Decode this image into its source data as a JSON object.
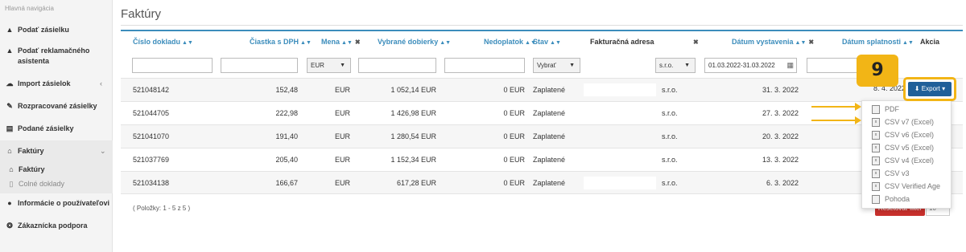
{
  "sidebar": {
    "title": "Hlavná navigácia",
    "items": [
      {
        "label": "Podať zásielku",
        "icon": "truck-icon"
      },
      {
        "label": "Podať reklamačného asistenta",
        "icon": "truck-icon"
      },
      {
        "label": "Import zásielok",
        "icon": "cloud-upload-icon"
      },
      {
        "label": "Rozpracované zásielky",
        "icon": "edit-icon"
      },
      {
        "label": "Podané zásielky",
        "icon": "archive-icon"
      },
      {
        "label": "Faktúry",
        "icon": "bank-icon"
      },
      {
        "label": "Informácie o používateľovi",
        "icon": "user-icon"
      },
      {
        "label": "Zákaznícka podpora",
        "icon": "support-icon"
      }
    ],
    "subitems": [
      {
        "label": "Faktúry",
        "icon": "bank-icon"
      },
      {
        "label": "Colné doklady",
        "icon": "document-icon"
      }
    ]
  },
  "page": {
    "title": "Faktúry"
  },
  "table": {
    "headers": {
      "doc_number": "Číslo dokladu",
      "amount": "Čiastka s DPH",
      "currency": "Mena",
      "collected": "Vybrané dobierky",
      "unpaid": "Nedoplatok",
      "status": "Stav",
      "address": "Fakturačná adresa",
      "issued": "Dátum vystavenia",
      "due": "Dátum splatnosti",
      "action": "Akcia"
    },
    "filters": {
      "currency": "EUR",
      "status": "Vybrať",
      "company": "s.r.o.",
      "date_range": "01.03.2022-31.03.2022"
    },
    "rows": [
      {
        "doc": "521048142",
        "amount": "152,48",
        "currency": "EUR",
        "collected": "1 052,14 EUR",
        "unpaid": "0 EUR",
        "status": "Zaplatené",
        "company": "s.r.o.",
        "issued": "31. 3. 2022",
        "due": "8. 4. 2022"
      },
      {
        "doc": "521044705",
        "amount": "222,98",
        "currency": "EUR",
        "collected": "1 426,98 EUR",
        "unpaid": "0 EUR",
        "status": "Zaplatené",
        "company": "s.r.o.",
        "issued": "27. 3. 2022",
        "due": ""
      },
      {
        "doc": "521041070",
        "amount": "191,40",
        "currency": "EUR",
        "collected": "1 280,54 EUR",
        "unpaid": "0 EUR",
        "status": "Zaplatené",
        "company": "s.r.o.",
        "issued": "20. 3. 2022",
        "due": ""
      },
      {
        "doc": "521037769",
        "amount": "205,40",
        "currency": "EUR",
        "collected": "1 152,34 EUR",
        "unpaid": "0 EUR",
        "status": "Zaplatené",
        "company": "s.r.o.",
        "issued": "13. 3. 2022",
        "due": ""
      },
      {
        "doc": "521034138",
        "amount": "166,67",
        "currency": "EUR",
        "collected": "617,28 EUR",
        "unpaid": "0 EUR",
        "status": "Zaplatené",
        "company": "s.r.o.",
        "issued": "6. 3. 2022",
        "due": ""
      }
    ],
    "footer": "( Položky: 1 - 5 z 5 )",
    "reset_label": "Resetovať filter",
    "page_size": "10"
  },
  "export": {
    "label": "Export",
    "options": [
      "PDF",
      "CSV v7 (Excel)",
      "CSV v6 (Excel)",
      "CSV v5 (Excel)",
      "CSV v4 (Excel)",
      "CSV v3",
      "CSV Verified Age",
      "Pohoda"
    ]
  },
  "annotation": {
    "step": "9"
  },
  "colors": {
    "accent": "#3c8dbc",
    "export_button": "#1f5f99",
    "highlight": "#f2b516",
    "danger": "#c9302c"
  }
}
